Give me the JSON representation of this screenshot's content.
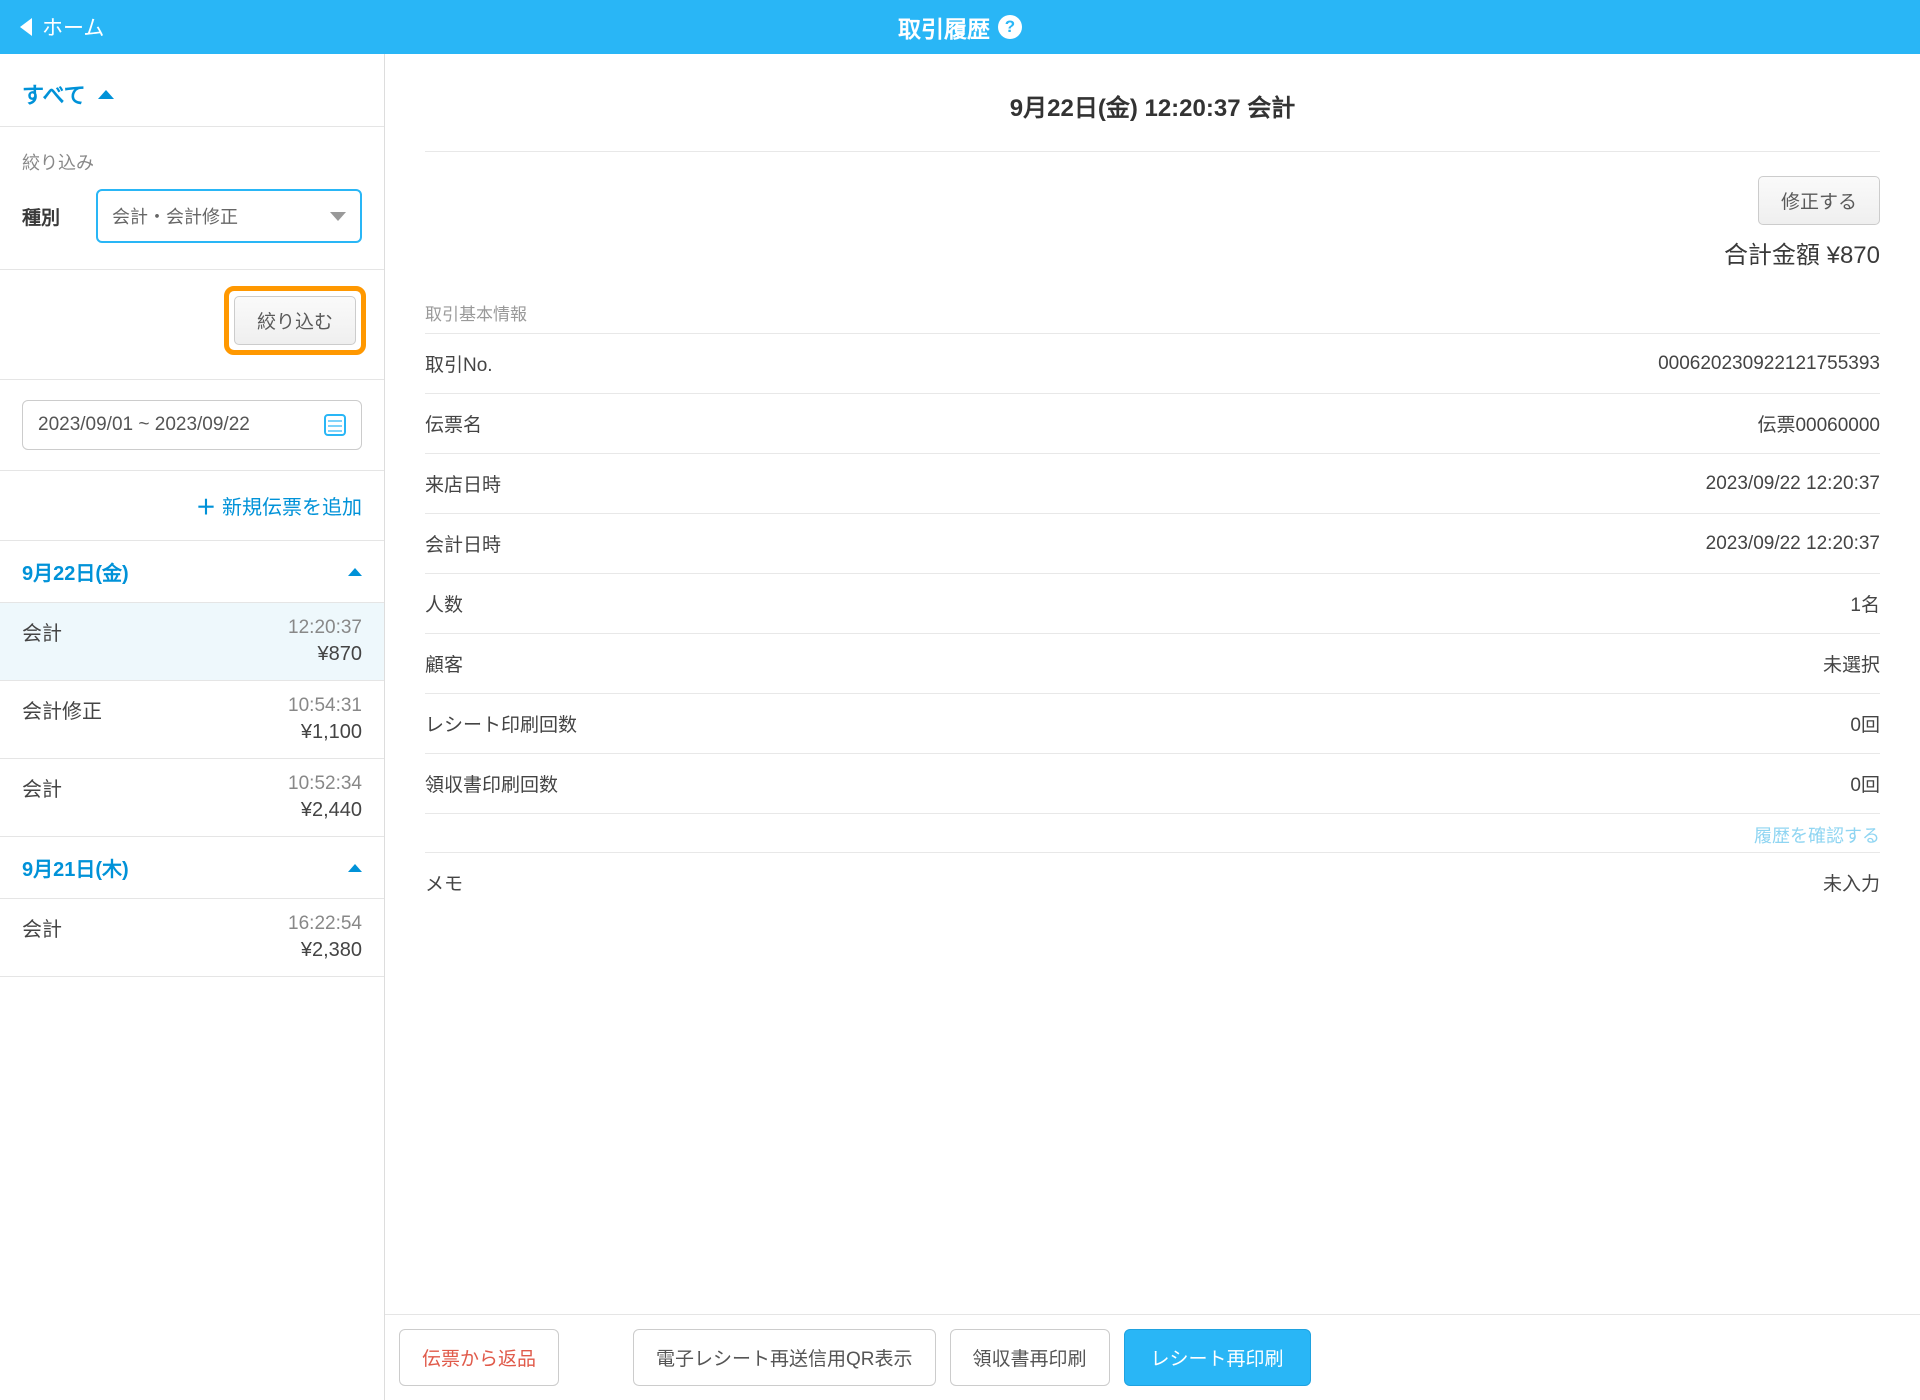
{
  "header": {
    "back_label": "ホーム",
    "title": "取引履歴"
  },
  "sidebar": {
    "all_label": "すべて",
    "filter_label": "絞り込み",
    "type_label": "種別",
    "type_value": "会計・会計修正",
    "apply_label": "絞り込む",
    "date_range": "2023/09/01 ~ 2023/09/22",
    "add_slip_label": "新規伝票を追加",
    "groups": [
      {
        "date_label": "9月22日(金)",
        "items": [
          {
            "type": "会計",
            "time": "12:20:37",
            "amount": "¥870",
            "selected": true
          },
          {
            "type": "会計修正",
            "time": "10:54:31",
            "amount": "¥1,100",
            "selected": false
          },
          {
            "type": "会計",
            "time": "10:52:34",
            "amount": "¥2,440",
            "selected": false
          }
        ]
      },
      {
        "date_label": "9月21日(木)",
        "items": [
          {
            "type": "会計",
            "time": "16:22:54",
            "amount": "¥2,380",
            "selected": false
          }
        ]
      }
    ]
  },
  "detail": {
    "title": "9月22日(金) 12:20:37 会計",
    "edit_label": "修正する",
    "total_label": "合計金額 ¥870",
    "section_label": "取引基本情報",
    "rows": {
      "tx_no_key": "取引No.",
      "tx_no_val": "00062023​0922121755393",
      "slip_key": "伝票名",
      "slip_val": "伝票00060000",
      "visit_key": "来店日時",
      "visit_val": "2023/09/22 12:20:37",
      "pay_key": "会計日時",
      "pay_val": "2023/09/22 12:20:37",
      "people_key": "人数",
      "people_val": "1名",
      "customer_key": "顧客",
      "customer_val": "未選択",
      "receipt_count_key": "レシート印刷回数",
      "receipt_count_val": "0回",
      "ryoshu_count_key": "領収書印刷回数",
      "ryoshu_count_val": "0回",
      "history_link": "履歴を確認する",
      "memo_key": "メモ",
      "memo_val": "未入力"
    }
  },
  "footer": {
    "return_label": "伝票から返品",
    "qr_label": "電子レシート再送信用QR表示",
    "ryoshu_label": "領収書再印刷",
    "receipt_label": "レシート再印刷"
  }
}
